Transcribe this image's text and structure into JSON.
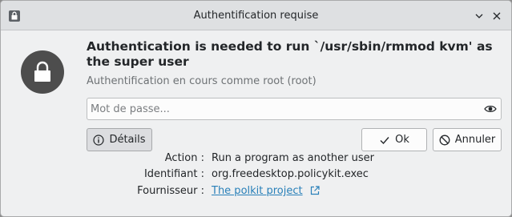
{
  "window": {
    "title": "Authentification requise",
    "icons": {
      "app": "lock-icon",
      "minimize": "chevron-down-icon",
      "close": "close-icon"
    }
  },
  "message": {
    "headline": "Authentication is needed to run `/usr/sbin/rmmod kvm' as the super user",
    "subtitle": "Authentification en cours comme root (root)",
    "icon": "lock-icon"
  },
  "password": {
    "placeholder": "Mot de passe...",
    "value": "",
    "reveal_icon": "eye-icon"
  },
  "buttons": {
    "details": {
      "label": "Détails",
      "icon": "info-icon"
    },
    "ok": {
      "label": "Ok",
      "icon": "checkmark-icon"
    },
    "cancel": {
      "label": "Annuler",
      "icon": "cancel-icon"
    }
  },
  "details": {
    "action_label": "Action :",
    "action_value": "Run a program as another user",
    "id_label": "Identifiant :",
    "id_value": "org.freedesktop.policykit.exec",
    "vendor_label": "Fournisseur :",
    "vendor_value": "The polkit project",
    "vendor_icon": "external-link-icon"
  },
  "colors": {
    "accent": "#2980b9",
    "window_bg": "#eff0f1",
    "titlebar_bg": "#dee0e2",
    "lock_circle": "#4d4d4d"
  }
}
